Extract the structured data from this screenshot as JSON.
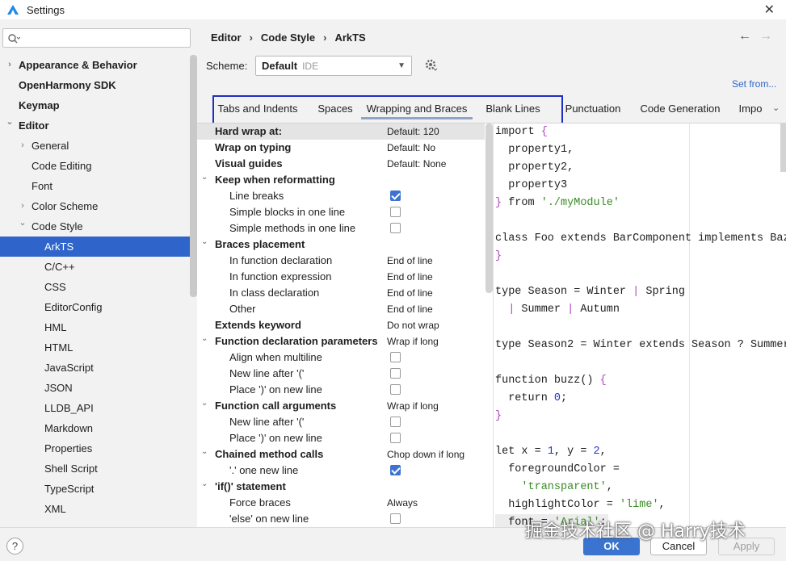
{
  "window": {
    "title": "Settings"
  },
  "search": {
    "value": "",
    "placeholder": ""
  },
  "tree": [
    {
      "label": "Appearance & Behavior",
      "bold": true,
      "arrow": "›",
      "indent": 0,
      "selected": false
    },
    {
      "label": "OpenHarmony SDK",
      "bold": true,
      "arrow": "",
      "indent": 0,
      "selected": false
    },
    {
      "label": "Keymap",
      "bold": true,
      "arrow": "",
      "indent": 0,
      "selected": false
    },
    {
      "label": "Editor",
      "bold": true,
      "arrow": "⌄",
      "indent": 0,
      "selected": false
    },
    {
      "label": "General",
      "bold": false,
      "arrow": "›",
      "indent": 1,
      "selected": false
    },
    {
      "label": "Code Editing",
      "bold": false,
      "arrow": "",
      "indent": 1,
      "selected": false
    },
    {
      "label": "Font",
      "bold": false,
      "arrow": "",
      "indent": 1,
      "selected": false
    },
    {
      "label": "Color Scheme",
      "bold": false,
      "arrow": "›",
      "indent": 1,
      "selected": false
    },
    {
      "label": "Code Style",
      "bold": false,
      "arrow": "⌄",
      "indent": 1,
      "selected": false
    },
    {
      "label": "ArkTS",
      "bold": false,
      "arrow": "",
      "indent": 2,
      "selected": true
    },
    {
      "label": "C/C++",
      "bold": false,
      "arrow": "",
      "indent": 2,
      "selected": false
    },
    {
      "label": "CSS",
      "bold": false,
      "arrow": "",
      "indent": 2,
      "selected": false
    },
    {
      "label": "EditorConfig",
      "bold": false,
      "arrow": "",
      "indent": 2,
      "selected": false
    },
    {
      "label": "HML",
      "bold": false,
      "arrow": "",
      "indent": 2,
      "selected": false
    },
    {
      "label": "HTML",
      "bold": false,
      "arrow": "",
      "indent": 2,
      "selected": false
    },
    {
      "label": "JavaScript",
      "bold": false,
      "arrow": "",
      "indent": 2,
      "selected": false
    },
    {
      "label": "JSON",
      "bold": false,
      "arrow": "",
      "indent": 2,
      "selected": false
    },
    {
      "label": "LLDB_API",
      "bold": false,
      "arrow": "",
      "indent": 2,
      "selected": false
    },
    {
      "label": "Markdown",
      "bold": false,
      "arrow": "",
      "indent": 2,
      "selected": false
    },
    {
      "label": "Properties",
      "bold": false,
      "arrow": "",
      "indent": 2,
      "selected": false
    },
    {
      "label": "Shell Script",
      "bold": false,
      "arrow": "",
      "indent": 2,
      "selected": false
    },
    {
      "label": "TypeScript",
      "bold": false,
      "arrow": "",
      "indent": 2,
      "selected": false
    },
    {
      "label": "XML",
      "bold": false,
      "arrow": "",
      "indent": 2,
      "selected": false
    }
  ],
  "breadcrumb": {
    "part1": "Editor",
    "part2": "Code Style",
    "part3": "ArkTS",
    "sep": "›"
  },
  "scheme": {
    "label": "Scheme:",
    "name": "Default",
    "sub": "IDE"
  },
  "set_from": "Set from...",
  "tabs": [
    "Tabs and Indents",
    "Spaces",
    "Wrapping and Braces",
    "Blank Lines",
    "Punctuation",
    "Code Generation",
    "Impo"
  ],
  "active_tab": "Wrapping and Braces",
  "options": [
    {
      "label": "Hard wrap at:",
      "bold": true,
      "toggle": "",
      "level": 0,
      "value": "Default: 120",
      "checkbox": null,
      "head": true
    },
    {
      "label": "Wrap on typing",
      "bold": true,
      "toggle": "",
      "level": 0,
      "value": "Default: No",
      "checkbox": null
    },
    {
      "label": "Visual guides",
      "bold": true,
      "toggle": "",
      "level": 0,
      "value": "Default: None",
      "checkbox": null
    },
    {
      "label": "Keep when reformatting",
      "bold": true,
      "toggle": "⌄",
      "level": 0,
      "value": "",
      "checkbox": null
    },
    {
      "label": "Line breaks",
      "bold": false,
      "toggle": "",
      "level": 1,
      "value": "",
      "checkbox": true
    },
    {
      "label": "Simple blocks in one line",
      "bold": false,
      "toggle": "",
      "level": 1,
      "value": "",
      "checkbox": false
    },
    {
      "label": "Simple methods in one line",
      "bold": false,
      "toggle": "",
      "level": 1,
      "value": "",
      "checkbox": false
    },
    {
      "label": "Braces placement",
      "bold": true,
      "toggle": "⌄",
      "level": 0,
      "value": "",
      "checkbox": null
    },
    {
      "label": "In function declaration",
      "bold": false,
      "toggle": "",
      "level": 1,
      "value": "End of line",
      "checkbox": null
    },
    {
      "label": "In function expression",
      "bold": false,
      "toggle": "",
      "level": 1,
      "value": "End of line",
      "checkbox": null
    },
    {
      "label": "In class declaration",
      "bold": false,
      "toggle": "",
      "level": 1,
      "value": "End of line",
      "checkbox": null
    },
    {
      "label": "Other",
      "bold": false,
      "toggle": "",
      "level": 1,
      "value": "End of line",
      "checkbox": null
    },
    {
      "label": "Extends keyword",
      "bold": true,
      "toggle": "",
      "level": 0,
      "value": "Do not wrap",
      "checkbox": null
    },
    {
      "label": "Function declaration parameters",
      "bold": true,
      "toggle": "⌄",
      "level": 0,
      "value": "Wrap if long",
      "checkbox": null
    },
    {
      "label": "Align when multiline",
      "bold": false,
      "toggle": "",
      "level": 1,
      "value": "",
      "checkbox": false
    },
    {
      "label": "New line after '('",
      "bold": false,
      "toggle": "",
      "level": 1,
      "value": "",
      "checkbox": false
    },
    {
      "label": "Place ')' on new line",
      "bold": false,
      "toggle": "",
      "level": 1,
      "value": "",
      "checkbox": false
    },
    {
      "label": "Function call arguments",
      "bold": true,
      "toggle": "⌄",
      "level": 0,
      "value": "Wrap if long",
      "checkbox": null
    },
    {
      "label": "New line after '('",
      "bold": false,
      "toggle": "",
      "level": 1,
      "value": "",
      "checkbox": false
    },
    {
      "label": "Place ')' on new line",
      "bold": false,
      "toggle": "",
      "level": 1,
      "value": "",
      "checkbox": false
    },
    {
      "label": "Chained method calls",
      "bold": true,
      "toggle": "⌄",
      "level": 0,
      "value": "Chop down if long",
      "checkbox": null
    },
    {
      "label": "'.' one new line",
      "bold": false,
      "toggle": "",
      "level": 1,
      "value": "",
      "checkbox": true
    },
    {
      "label": "'if()' statement",
      "bold": true,
      "toggle": "⌄",
      "level": 0,
      "value": "",
      "checkbox": null
    },
    {
      "label": "Force braces",
      "bold": false,
      "toggle": "",
      "level": 1,
      "value": "Always",
      "checkbox": null
    },
    {
      "label": "'else' on new line",
      "bold": false,
      "toggle": "",
      "level": 1,
      "value": "",
      "checkbox": false
    }
  ],
  "code_lines": [
    [
      {
        "t": "import ",
        "c": "kw"
      },
      {
        "t": "{",
        "c": "punc"
      }
    ],
    [
      {
        "t": "  property1,",
        "c": "kw"
      }
    ],
    [
      {
        "t": "  property2,",
        "c": "kw"
      }
    ],
    [
      {
        "t": "  property3",
        "c": "kw"
      }
    ],
    [
      {
        "t": "} ",
        "c": "punc"
      },
      {
        "t": "from ",
        "c": "kw"
      },
      {
        "t": "'./myModule'",
        "c": "str"
      }
    ],
    [
      {
        "t": "",
        "c": "kw"
      }
    ],
    [
      {
        "t": "class Foo extends BarComponent implements Baz",
        "c": "kw"
      }
    ],
    [
      {
        "t": "}",
        "c": "punc"
      }
    ],
    [
      {
        "t": "",
        "c": "kw"
      }
    ],
    [
      {
        "t": "type Season = Winter ",
        "c": "kw"
      },
      {
        "t": "|",
        "c": "punc"
      },
      {
        "t": " Spring",
        "c": "kw"
      }
    ],
    [
      {
        "t": "  ",
        "c": "kw"
      },
      {
        "t": "|",
        "c": "punc"
      },
      {
        "t": " Summer ",
        "c": "kw"
      },
      {
        "t": "|",
        "c": "punc"
      },
      {
        "t": " Autumn",
        "c": "kw"
      }
    ],
    [
      {
        "t": "",
        "c": "kw"
      }
    ],
    [
      {
        "t": "type Season2 = Winter extends Season ? Summer",
        "c": "kw"
      }
    ],
    [
      {
        "t": "",
        "c": "kw"
      }
    ],
    [
      {
        "t": "function buzz() ",
        "c": "kw"
      },
      {
        "t": "{",
        "c": "punc"
      }
    ],
    [
      {
        "t": "  return ",
        "c": "kw"
      },
      {
        "t": "0",
        "c": "num"
      },
      {
        "t": ";",
        "c": "kw"
      }
    ],
    [
      {
        "t": "}",
        "c": "punc"
      }
    ],
    [
      {
        "t": "",
        "c": "kw"
      }
    ],
    [
      {
        "t": "let x = ",
        "c": "kw"
      },
      {
        "t": "1",
        "c": "num"
      },
      {
        "t": ", y = ",
        "c": "kw"
      },
      {
        "t": "2",
        "c": "num"
      },
      {
        "t": ",",
        "c": "kw"
      }
    ],
    [
      {
        "t": "  foregroundColor =",
        "c": "kw"
      }
    ],
    [
      {
        "t": "    ",
        "c": "kw"
      },
      {
        "t": "'transparent'",
        "c": "str"
      },
      {
        "t": ",",
        "c": "kw"
      }
    ],
    [
      {
        "t": "  highlightColor = ",
        "c": "kw"
      },
      {
        "t": "'lime'",
        "c": "str"
      },
      {
        "t": ",",
        "c": "kw"
      }
    ],
    [
      {
        "t": "  font = ",
        "c": "kw"
      },
      {
        "t": "'Arial'",
        "c": "str"
      },
      {
        "t": ";",
        "c": "kw"
      }
    ]
  ],
  "buttons": {
    "ok": "OK",
    "cancel": "Cancel",
    "apply": "Apply",
    "help": "?"
  },
  "watermark": "掘金技术社区 @ Harry技术",
  "colors": {
    "accent": "#2f65ca",
    "selection": "#2f65ca",
    "tab_highlight_border": "#1f2fc0",
    "string": "#3a8a26",
    "number": "#2035c2",
    "brace": "#b146c2"
  }
}
